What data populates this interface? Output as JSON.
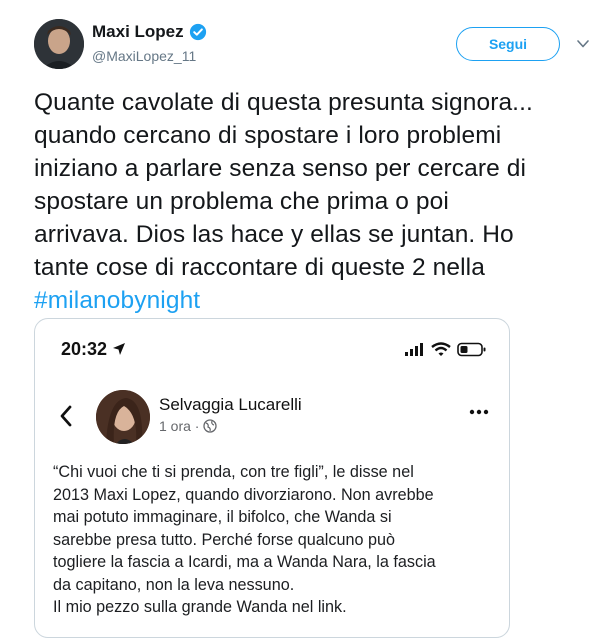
{
  "tweet": {
    "author_name": "Maxi Lopez",
    "handle": "@MaxiLopez_11",
    "follow_label": "Segui",
    "text_lines": [
      "Quante cavolate di questa presunta signora...",
      "quando cercano di spostare i loro problemi",
      "iniziano a parlare senza senso per cercare di",
      "spostare un problema che prima o poi",
      "arrivava. Dios las hace y ellas se juntan. Ho",
      "tante cose di raccontare di queste 2 nella"
    ],
    "hashtag": "#milanobynight",
    "icons": {
      "verified": "verified-badge-icon",
      "menu": "chevron-down-icon"
    },
    "colors": {
      "accent": "#1da1f2",
      "text": "#14171a",
      "muted": "#657786"
    }
  },
  "embedded_screenshot": {
    "status_time": "20:32",
    "post": {
      "author": "Selvaggia Lucarelli",
      "meta": "1 ora ·",
      "text_lines": [
        "“Chi vuoi che ti si prenda, con tre figli”, le disse nel",
        "2013 Maxi Lopez, quando divorziarono. Non avrebbe",
        "mai potuto immaginare, il bifolco, che Wanda si",
        "sarebbe presa tutto. Perché forse qualcuno può",
        "togliere la fascia a Icardi, ma a Wanda Nara, la fascia",
        "da capitano, non la leva nessuno.",
        "Il mio pezzo sulla grande Wanda nel link."
      ]
    },
    "icons": {
      "location": "location-arrow-icon",
      "signal": "signal-icon",
      "wifi": "wifi-icon",
      "battery": "battery-icon",
      "back": "back-arrow-icon",
      "globe": "globe-icon",
      "more": "more-dots-icon"
    }
  }
}
